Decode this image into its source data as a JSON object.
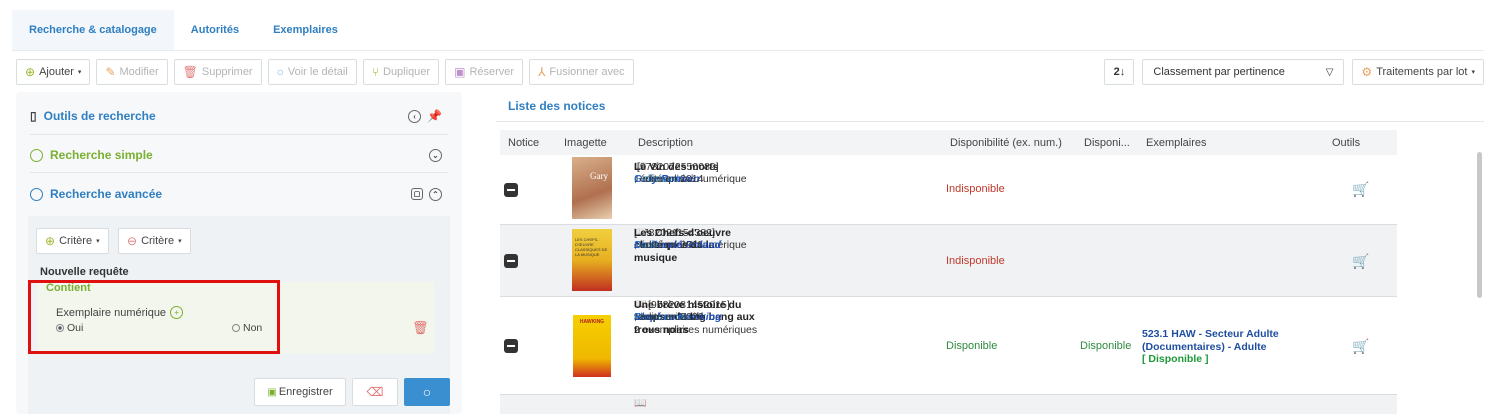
{
  "tabs": [
    {
      "label": "Recherche & catalogage"
    },
    {
      "label": "Autorités"
    },
    {
      "label": "Exemplaires"
    }
  ],
  "toolbar": {
    "add": "Ajouter",
    "edit": "Modifier",
    "delete": "Supprimer",
    "view_detail": "Voir le détail",
    "duplicate": "Dupliquer",
    "reserve": "Réserver",
    "merge": "Fusionner avec"
  },
  "sort": {
    "icon_label": "2↓",
    "selected": "Classement par pertinence",
    "batch": "Traitements par lot"
  },
  "left_panel": {
    "tools_title": "Outils de recherche",
    "simple_search": "Recherche simple",
    "advanced_search": "Recherche avancée",
    "criteria_add": "Critère",
    "criteria_remove": "Critère",
    "new_query": "Nouvelle requête",
    "contains": "Contient",
    "field_label": "Exemplaire numérique",
    "option_yes": "Oui",
    "option_no": "Non",
    "save": "Enregistrer"
  },
  "list": {
    "title": "Liste des notices",
    "columns": [
      "Notice",
      "Imagette",
      "Description",
      "Disponibilité (ex. num.)",
      "Disponi...",
      "Exemplaires",
      "Outils"
    ],
    "rows": [
      {
        "title": "Le Vin des morts",
        "isbn": "[9782072550089]",
        "author": "Gary Romain",
        "publisher": "Gallimard",
        "edition": ", édité en 2014",
        "copies": "1 exemplaire numérique",
        "availability_num": "Indisponible"
      },
      {
        "title": "Les Chefs-d'oeuvre classiques de la musique",
        "isbn": "[9782021154382]",
        "author": "De Candé Roland",
        "publisher": "Seuil",
        "edition": ", édité en 2011",
        "copies": "1 exemplaire numérique",
        "availability_num": "Indisponible"
      },
      {
        "title": "Une brève histoire du temps : du big bang aux trous noirs",
        "isbn": "[9782081452015]",
        "author": "Stephen Hawking",
        "publisher": "Flammarion",
        "edition": ", édité en 2020",
        "copies_site": "1 ex. sur le site",
        "copies": "2 exemplaires numériques",
        "availability_num": "Disponible",
        "availability": "Disponible",
        "holding_line1": "523.1 HAW - Secteur Adulte",
        "holding_line2": "(Documentaires) - Adulte",
        "holding_status": "[ Disponible ]"
      }
    ]
  },
  "thumb_text": {
    "cover1": "Gary",
    "cover2": "LES CHEFS-D'ŒUVRE CLASSIQUES DE LA MUSIQUE",
    "cover3": "HAWKING"
  },
  "colors": {
    "accent": "#2f7fc1",
    "unavailable": "#c0392b",
    "available": "#2e8b3c",
    "highlight_box": "#e01010"
  }
}
